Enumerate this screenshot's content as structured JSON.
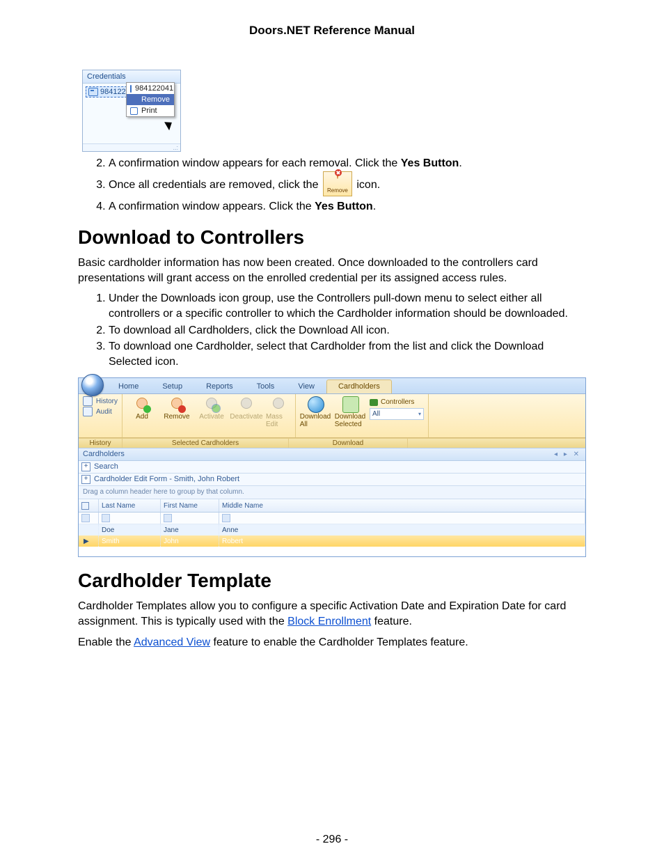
{
  "doc": {
    "header": "Doors.NET Reference Manual",
    "page_number": "- 296 -"
  },
  "cred_panel": {
    "title": "Credentials",
    "item": "984122041",
    "menu": {
      "check": "984122041",
      "remove": "Remove",
      "print": "Print"
    }
  },
  "steps_top": {
    "s2_a": "A confirmation window appears for each removal. Click the ",
    "s2_b": "Yes Button",
    "s2_c": ".",
    "s3_a": "Once all credentials are removed, click the ",
    "s3_b": " icon.",
    "remove_icon_label": "Remove",
    "s4_a": "A confirmation window appears. Click the ",
    "s4_b": "Yes Button",
    "s4_c": "."
  },
  "download": {
    "heading": "Download to Controllers",
    "intro": "Basic cardholder information has now been created. Once downloaded to the controllers card presentations will grant access on the enrolled credential per its assigned access rules.",
    "li1": "Under the Downloads icon group, use the Controllers pull-down menu to select either all controllers or a specific controller to which the Cardholder information should be downloaded.",
    "li2": "To download all Cardholders, click the Download All icon.",
    "li3": "To download one Cardholder, select that Cardholder from the list and click the Download Selected icon."
  },
  "app": {
    "tabs": [
      "Home",
      "Setup",
      "Reports",
      "Tools",
      "View",
      "Cardholders"
    ],
    "active_tab": 5,
    "side": {
      "history": "History",
      "audit": "Audit"
    },
    "ribbon": {
      "add": "Add",
      "remove": "Remove",
      "activate": "Activate",
      "deactivate": "Deactivate",
      "mass_edit": "Mass Edit",
      "download_all": "Download All",
      "download_selected": "Download Selected",
      "controllers_label": "Controllers",
      "controllers_value": "All"
    },
    "groups": {
      "history": "History",
      "selected": "Selected Cardholders",
      "download": "Download"
    },
    "panel_title": "Cardholders",
    "panel_tools": "◂ ▸ ✕",
    "search": "Search",
    "edit_form": "Cardholder Edit Form - Smith, John Robert",
    "group_hint": "Drag a column header here to group by that column.",
    "columns": {
      "lastname": "Last Name",
      "firstname": "First Name",
      "middlename": "Middle Name"
    },
    "rows": [
      {
        "last": "Doe",
        "first": "Jane",
        "middle": "Anne"
      },
      {
        "last": "Smith",
        "first": "John",
        "middle": "Robert"
      }
    ]
  },
  "template": {
    "heading": "Cardholder Template",
    "p1_a": "Cardholder Templates allow you to configure a specific Activation Date and Expiration Date for card assignment. This is typically used with the ",
    "p1_link": "Block Enrollment",
    "p1_b": " feature.",
    "p2_a": "Enable the ",
    "p2_link": "Advanced View",
    "p2_b": " feature to enable the Cardholder Templates feature."
  }
}
